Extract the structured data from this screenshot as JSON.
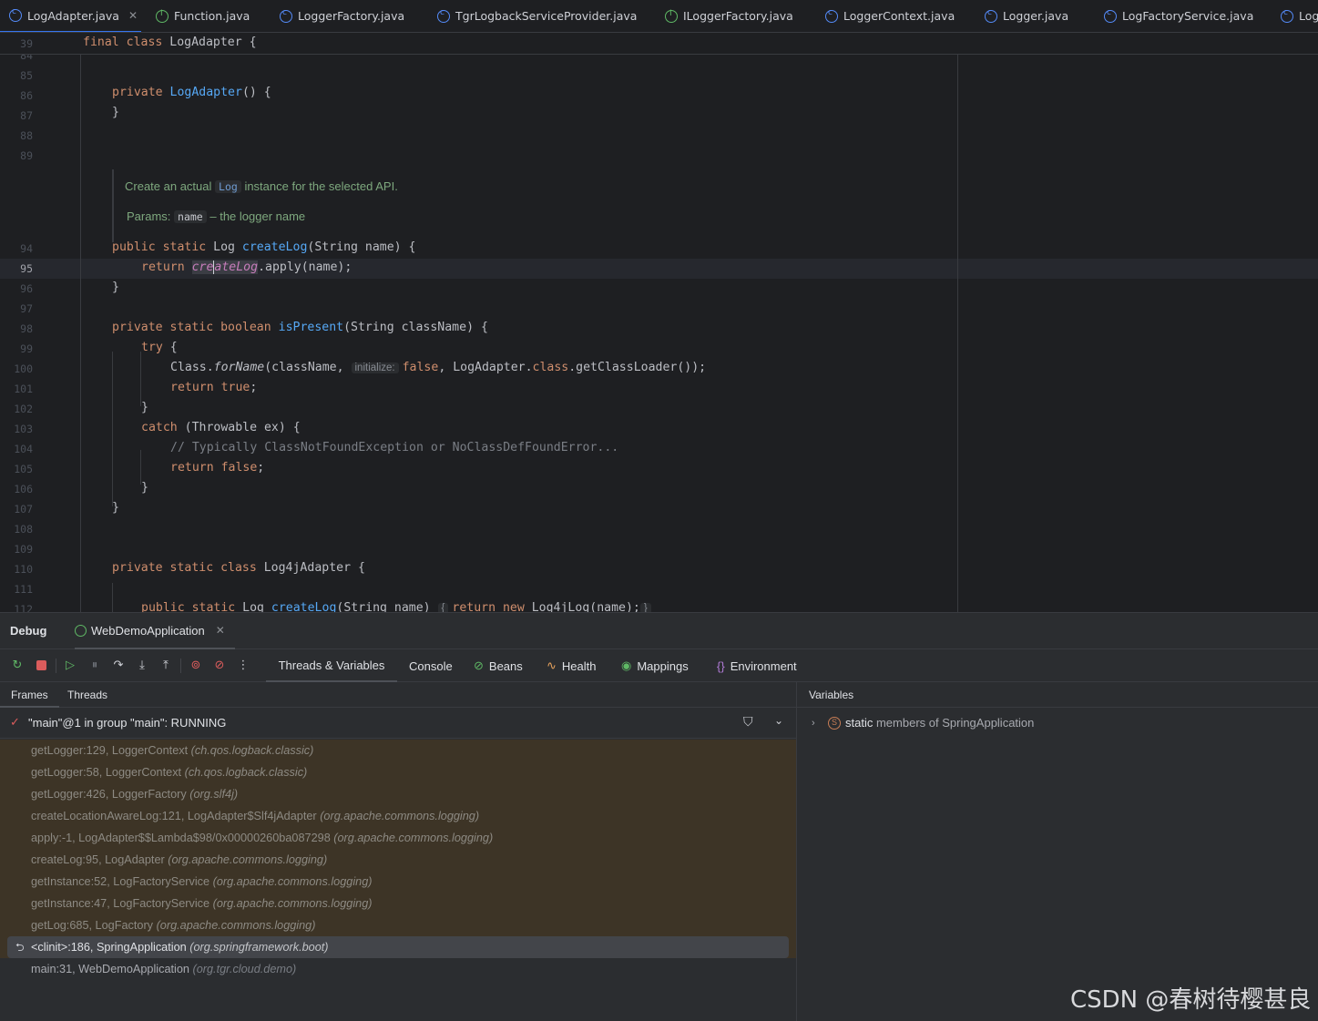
{
  "tabs": [
    {
      "label": "LogAdapter.java",
      "icon": "class-icon",
      "active": true
    },
    {
      "label": "Function.java",
      "icon": "interface-icon"
    },
    {
      "label": "LoggerFactory.java",
      "icon": "class-icon"
    },
    {
      "label": "TgrLogbackServiceProvider.java",
      "icon": "class-icon"
    },
    {
      "label": "ILoggerFactory.java",
      "icon": "interface-icon"
    },
    {
      "label": "LoggerContext.java",
      "icon": "class-icon"
    },
    {
      "label": "Logger.java",
      "icon": "class-icon"
    },
    {
      "label": "LogFactoryService.java",
      "icon": "class-icon"
    },
    {
      "label": "Log",
      "icon": "class-icon"
    }
  ],
  "editor": {
    "sticky_line_number": "39",
    "sticky_code": "final class LogAdapter {",
    "line_numbers": [
      "84",
      "85",
      "86",
      "87",
      "88",
      "89",
      "94",
      "95",
      "96",
      "97",
      "98",
      "99",
      "100",
      "101",
      "102",
      "103",
      "104",
      "105",
      "106",
      "107",
      "108",
      "109",
      "110",
      "111",
      "112"
    ],
    "current_line": "95",
    "doc": {
      "text_before": "Create an actual",
      "code_ref": "Log",
      "text_after": "instance for the selected API.",
      "params_label": "Params:",
      "param_name": "name",
      "param_desc": "– the logger name"
    },
    "inlay_hint": "initialize:",
    "comment": "// Typically ClassNotFoundException or NoClassDefFoundError..."
  },
  "debug": {
    "title": "Debug",
    "session_tab": "WebDemoApplication",
    "view_tabs": [
      "Threads & Variables",
      "Console",
      "Beans",
      "Health",
      "Mappings",
      "Environment"
    ],
    "subtabs": [
      "Frames",
      "Threads"
    ],
    "thread_status": "\"main\"@1 in group \"main\": RUNNING",
    "frames": [
      {
        "method": "getLogger:129, LoggerContext",
        "pkg": "(ch.qos.logback.classic)",
        "kind": "lib"
      },
      {
        "method": "getLogger:58, LoggerContext",
        "pkg": "(ch.qos.logback.classic)",
        "kind": "lib"
      },
      {
        "method": "getLogger:426, LoggerFactory",
        "pkg": "(org.slf4j)",
        "kind": "lib"
      },
      {
        "method": "createLocationAwareLog:121, LogAdapter$Slf4jAdapter",
        "pkg": "(org.apache.commons.logging)",
        "kind": "lib"
      },
      {
        "method": "apply:-1, LogAdapter$$Lambda$98/0x00000260ba087298",
        "pkg": "(org.apache.commons.logging)",
        "kind": "lib"
      },
      {
        "method": "createLog:95, LogAdapter",
        "pkg": "(org.apache.commons.logging)",
        "kind": "lib"
      },
      {
        "method": "getInstance:52, LogFactoryService",
        "pkg": "(org.apache.commons.logging)",
        "kind": "lib"
      },
      {
        "method": "getInstance:47, LogFactoryService",
        "pkg": "(org.apache.commons.logging)",
        "kind": "lib"
      },
      {
        "method": "getLog:685, LogFactory",
        "pkg": "(org.apache.commons.logging)",
        "kind": "lib"
      },
      {
        "method": "<clinit>:186, SpringApplication",
        "pkg": "(org.springframework.boot)",
        "kind": "sel"
      },
      {
        "method": "main:31, WebDemoApplication",
        "pkg": "(org.tgr.cloud.demo)",
        "kind": "plain"
      }
    ],
    "variables_header": "Variables",
    "variable_row": {
      "name": "static",
      "rest": "members of SpringApplication"
    }
  },
  "watermark": "CSDN @春树待樱甚良",
  "colors": {
    "accent": "#3574f0",
    "keyword": "#cf8e6d",
    "function": "#56a8f5",
    "library_frame_bg": "#3d3426"
  }
}
